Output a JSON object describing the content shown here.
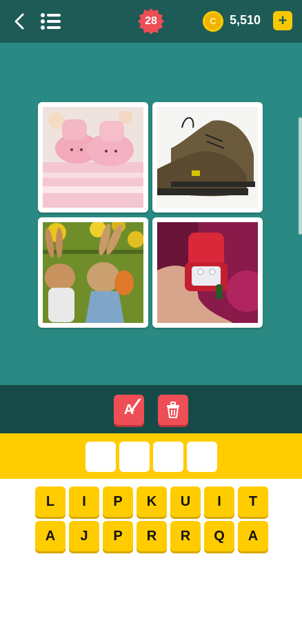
{
  "header": {
    "level": "28",
    "coins": "5,510",
    "plus_label": "+",
    "coin_symbol": "C"
  },
  "hints": {
    "reveal_label": "A",
    "remove_label": ""
  },
  "images": [
    {
      "subject": "pink knitted baby booties"
    },
    {
      "subject": "brown hiking shoes"
    },
    {
      "subject": "ceramic bunny figurines"
    },
    {
      "subject": "ring box held in hand"
    }
  ],
  "answer_slots": [
    "",
    "",
    "",
    ""
  ],
  "keyboard": {
    "row1": [
      "L",
      "I",
      "P",
      "K",
      "U",
      "I",
      "T"
    ],
    "row2": [
      "A",
      "J",
      "P",
      "R",
      "R",
      "Q",
      "A"
    ]
  },
  "colors": {
    "topbar": "#1e5a56",
    "main": "#2a8a83",
    "hintbar": "#154a47",
    "accent": "#ffcc00",
    "hint_button": "#ee4e56"
  }
}
